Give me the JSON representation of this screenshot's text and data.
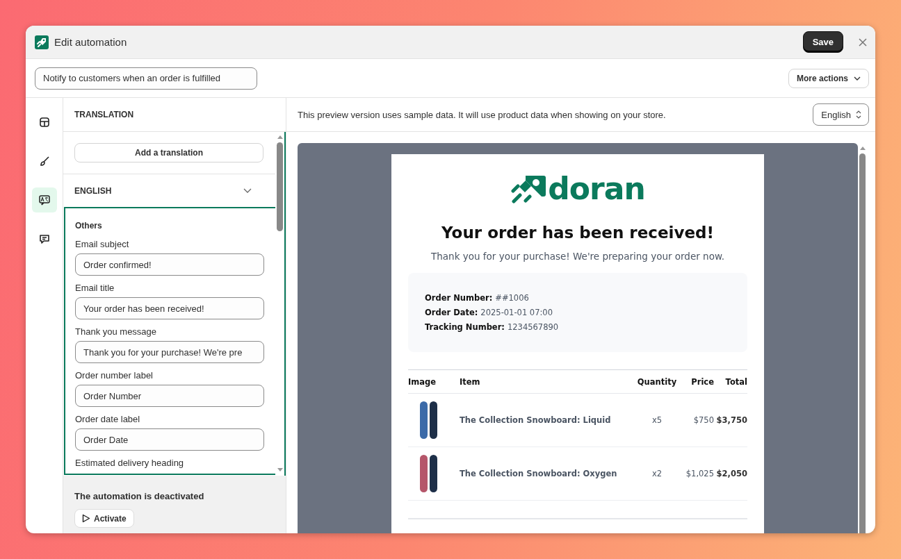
{
  "window": {
    "title": "Edit automation",
    "save": "Save"
  },
  "toolbar": {
    "automation_name": "Notify to customers when an order is fulfilled",
    "more_actions": "More actions"
  },
  "rail": [
    {
      "kind": "layout",
      "selected": false
    },
    {
      "kind": "brush",
      "selected": false
    },
    {
      "kind": "translate",
      "selected": true
    },
    {
      "kind": "chat",
      "selected": false
    }
  ],
  "panel": {
    "title": "TRANSLATION",
    "add_translation": "Add a translation",
    "language": {
      "label": "ENGLISH",
      "expanded": false
    },
    "group": "Others",
    "fields": [
      {
        "label": "Email subject",
        "value": "Order confirmed!"
      },
      {
        "label": "Email title",
        "value": "Your order has been received!"
      },
      {
        "label": "Thank you message",
        "value": "Thank you for your purchase! We're pre"
      },
      {
        "label": "Order number label",
        "value": "Order Number"
      },
      {
        "label": "Order date label",
        "value": "Order Date"
      },
      {
        "label": "Estimated delivery heading"
      }
    ],
    "status": "The automation is deactivated",
    "activate": "Activate"
  },
  "preview": {
    "notice": "This preview version uses sample data. It will use product data when showing on your store.",
    "language": "English",
    "email": {
      "logo": "doran",
      "title": "Your order has been received!",
      "message": "Thank you for your purchase! We're preparing your order now.",
      "details": [
        {
          "label": "Order Number:",
          "value": "##1006"
        },
        {
          "label": "Order Date:",
          "value": "2025-01-01 07:00"
        },
        {
          "label": "Tracking Number:",
          "value": "1234567890"
        }
      ],
      "columns": [
        "Image",
        "Item",
        "Quantity",
        "Price",
        "Total"
      ],
      "rows": [
        {
          "item": "The Collection Snowboard: Liquid",
          "quantity": "x5",
          "price": "$750",
          "total": "$3,750",
          "color": "#3b6aa8"
        },
        {
          "item": "The Collection Snowboard: Oxygen",
          "quantity": "x2",
          "price": "$1,025",
          "total": "$2,050",
          "color": "#b5566a"
        }
      ]
    }
  }
}
